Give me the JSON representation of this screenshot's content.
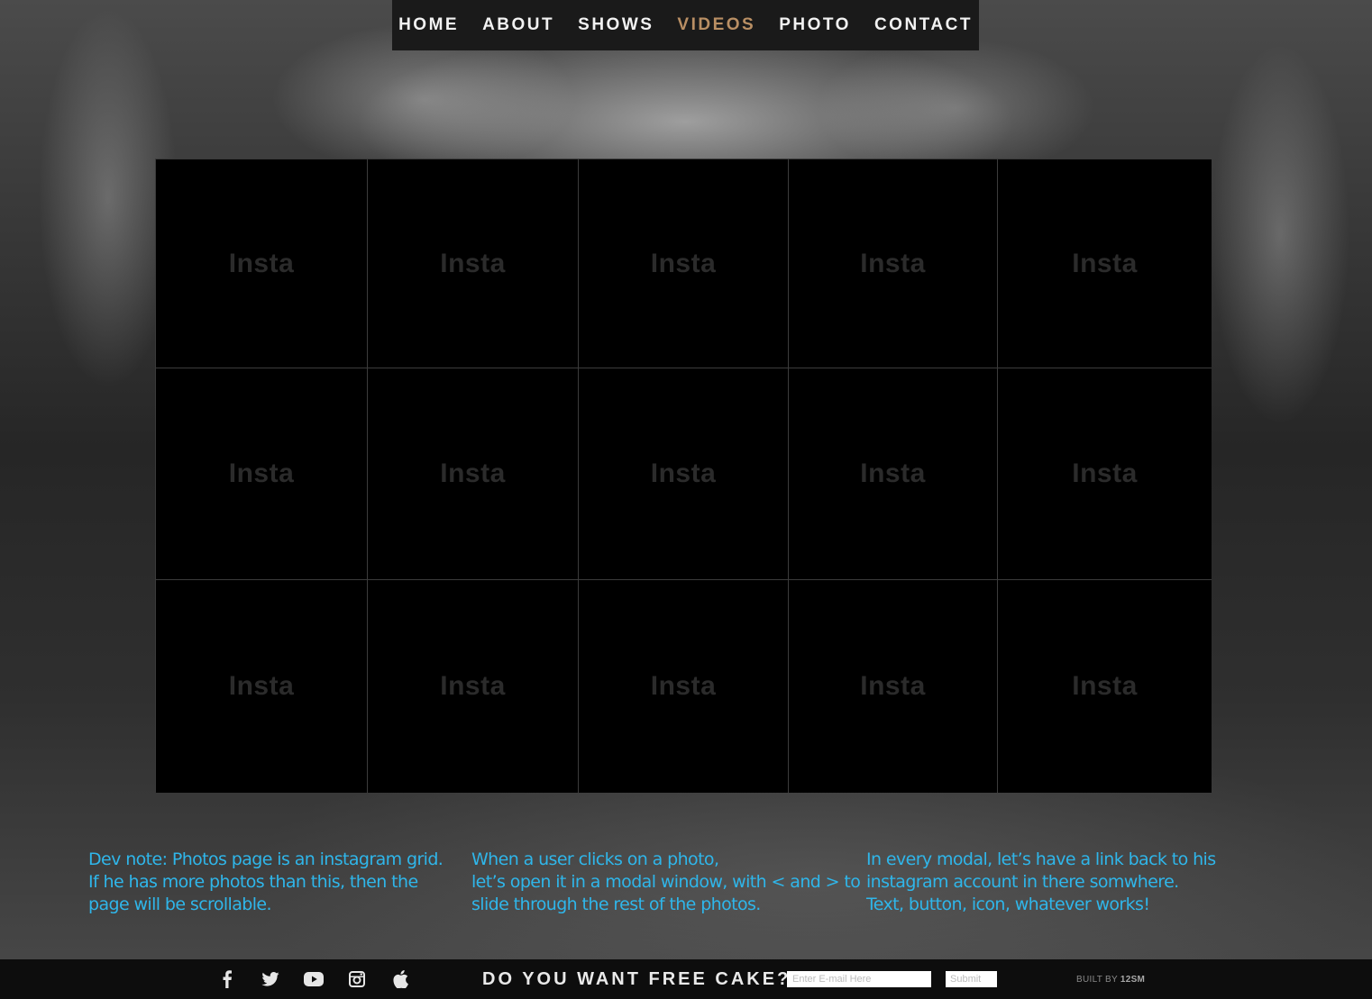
{
  "nav": {
    "items": [
      {
        "label": "HOME"
      },
      {
        "label": "ABOUT"
      },
      {
        "label": "SHOWS"
      },
      {
        "label": "VIDEOS",
        "active": true
      },
      {
        "label": "PHOTO"
      },
      {
        "label": "CONTACT"
      }
    ],
    "active_color": "#b98f64"
  },
  "grid": {
    "tiles": [
      "Insta",
      "Insta",
      "Insta",
      "Insta",
      "Insta",
      "Insta",
      "Insta",
      "Insta",
      "Insta",
      "Insta",
      "Insta",
      "Insta",
      "Insta",
      "Insta",
      "Insta"
    ]
  },
  "notes": {
    "color": "#2fb6ea",
    "col1": [
      "Dev note: Photos page is an instagram grid.",
      "If he has more photos than this, then the",
      "page will be scrollable."
    ],
    "col2": [
      "When a user clicks on a photo,",
      "let’s open it in a modal window, with < and > to",
      "slide through the rest of the photos."
    ],
    "col3": [
      "In every modal, let’s have a link back to his",
      "instagram account in there somwhere.",
      "Text, button, icon, whatever works!"
    ]
  },
  "footer": {
    "social_icons": [
      "facebook-icon",
      "twitter-icon",
      "youtube-icon",
      "instagram-icon",
      "apple-icon"
    ],
    "cta": "DO YOU WANT FREE CAKE?",
    "email_placeholder": "Enter E-mail Here",
    "submit_label": "Submit",
    "built_by": "BUILT BY",
    "built_brand": "12SM"
  }
}
